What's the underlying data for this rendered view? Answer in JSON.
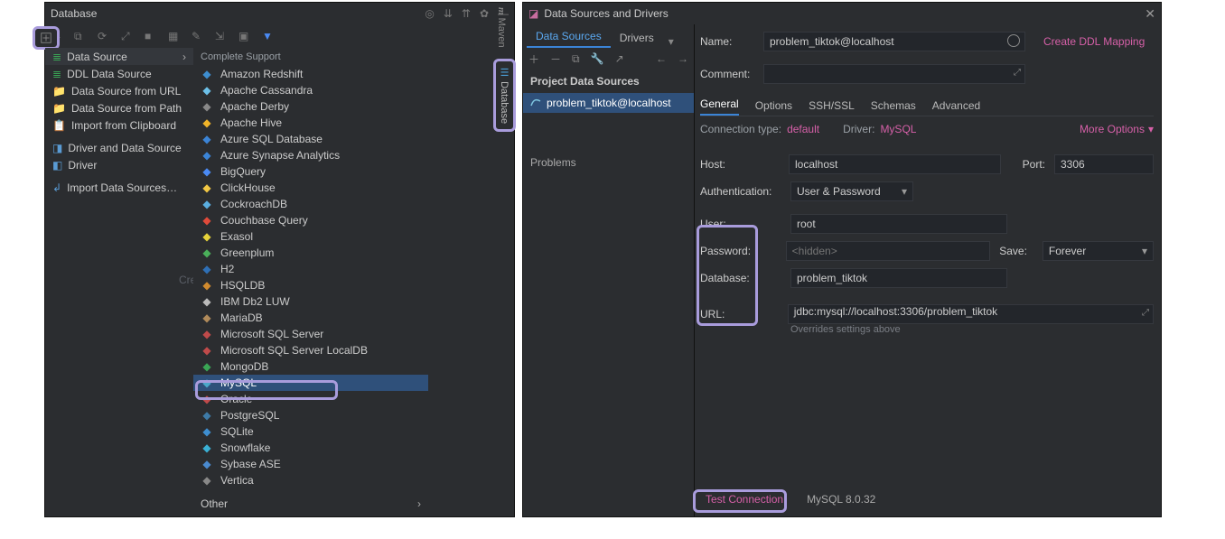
{
  "left": {
    "title": "Database",
    "hint": "Cre",
    "ctx1": {
      "data_source": "Data Source",
      "ddl": "DDL Data Source",
      "from_url": "Data Source from URL",
      "from_path": "Data Source from Path",
      "import_clipboard": "Import from Clipboard",
      "driver_and_ds": "Driver and Data Source",
      "driver": "Driver",
      "import_ds": "Import Data Sources…"
    },
    "ctx2_header": "Complete Support",
    "ctx2": [
      {
        "label": "Amazon Redshift",
        "color": "#3e8ed0"
      },
      {
        "label": "Apache Cassandra",
        "color": "#6cc0e8"
      },
      {
        "label": "Apache Derby",
        "color": "#888"
      },
      {
        "label": "Apache Hive",
        "color": "#f0b429"
      },
      {
        "label": "Azure SQL Database",
        "color": "#3b84d6"
      },
      {
        "label": "Azure Synapse Analytics",
        "color": "#3b84d6"
      },
      {
        "label": "BigQuery",
        "color": "#4a8af4"
      },
      {
        "label": "ClickHouse",
        "color": "#f2c744"
      },
      {
        "label": "CockroachDB",
        "color": "#5aaee0"
      },
      {
        "label": "Couchbase Query",
        "color": "#e04a3a"
      },
      {
        "label": "Exasol",
        "color": "#e6d23a"
      },
      {
        "label": "Greenplum",
        "color": "#4aaf5a"
      },
      {
        "label": "H2",
        "color": "#2e6fb5"
      },
      {
        "label": "HSQLDB",
        "color": "#d08a2e"
      },
      {
        "label": "IBM Db2 LUW",
        "color": "#bbb"
      },
      {
        "label": "MariaDB",
        "color": "#b08a5a"
      },
      {
        "label": "Microsoft SQL Server",
        "color": "#c04a4a"
      },
      {
        "label": "Microsoft SQL Server LocalDB",
        "color": "#c04a4a"
      },
      {
        "label": "MongoDB",
        "color": "#3aa655"
      },
      {
        "label": "MySQL",
        "color": "#4aa8c9"
      },
      {
        "label": "Oracle",
        "color": "#c04a4a"
      },
      {
        "label": "PostgreSQL",
        "color": "#3e7aa6"
      },
      {
        "label": "SQLite",
        "color": "#3e8ed0"
      },
      {
        "label": "Snowflake",
        "color": "#3ab0d4"
      },
      {
        "label": "Sybase ASE",
        "color": "#4a8acf"
      },
      {
        "label": "Vertica",
        "color": "#888"
      }
    ],
    "other": "Other"
  },
  "side_tabs": {
    "maven": "Maven",
    "database": "Database"
  },
  "right": {
    "title": "Data Sources and Drivers",
    "tabs": {
      "data_sources": "Data Sources",
      "drivers": "Drivers"
    },
    "tree_header": "Project Data Sources",
    "tree_item": "problem_tiktok@localhost",
    "problems": "Problems",
    "name_lbl": "Name:",
    "name_val": "problem_tiktok@localhost",
    "ddl_link": "Create DDL Mapping",
    "comment_lbl": "Comment:",
    "comment_val": "",
    "sub_tabs": {
      "general": "General",
      "options": "Options",
      "sshssl": "SSH/SSL",
      "schemas": "Schemas",
      "advanced": "Advanced"
    },
    "conn_type_lbl": "Connection type:",
    "conn_type_val": "default",
    "driver_lbl": "Driver:",
    "driver_val": "MySQL",
    "more_options": "More Options",
    "host_lbl": "Host:",
    "host_val": "localhost",
    "port_lbl": "Port:",
    "port_val": "3306",
    "auth_lbl": "Authentication:",
    "auth_val": "User & Password",
    "user_lbl": "User:",
    "user_val": "root",
    "pw_lbl": "Password:",
    "pw_placeholder": "<hidden>",
    "save_lbl": "Save:",
    "save_val": "Forever",
    "db_lbl": "Database:",
    "db_val": "problem_tiktok",
    "url_lbl": "URL:",
    "url_val": "jdbc:mysql://localhost:3306/problem_tiktok",
    "override_hint": "Overrides settings above",
    "test_conn": "Test Connection",
    "version": "MySQL 8.0.32"
  }
}
